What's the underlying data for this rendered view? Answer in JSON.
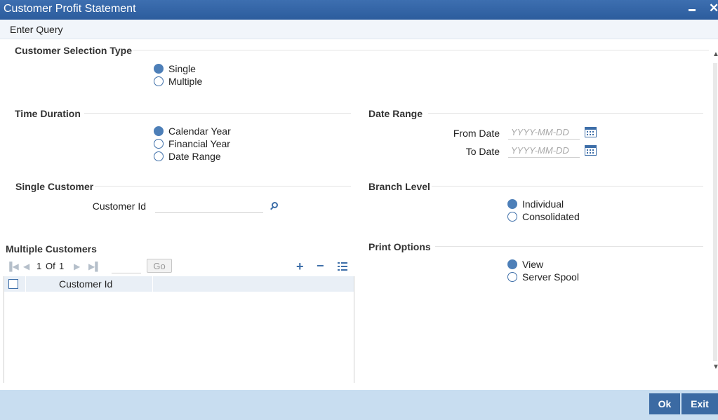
{
  "window": {
    "title": "Customer Profit Statement"
  },
  "menu": {
    "enter_query": "Enter Query"
  },
  "customer_selection": {
    "title": "Customer Selection Type",
    "options": [
      {
        "label": "Single",
        "selected": true
      },
      {
        "label": "Multiple",
        "selected": false
      }
    ]
  },
  "time_duration": {
    "title": "Time Duration",
    "options": [
      {
        "label": "Calendar Year",
        "selected": true
      },
      {
        "label": "Financial Year",
        "selected": false
      },
      {
        "label": "Date Range",
        "selected": false
      }
    ]
  },
  "date_range": {
    "title": "Date Range",
    "from_label": "From Date",
    "to_label": "To Date",
    "date_placeholder": "YYYY-MM-DD"
  },
  "single_customer": {
    "title": "Single Customer",
    "customer_id_label": "Customer Id",
    "customer_id_value": ""
  },
  "branch_level": {
    "title": "Branch Level",
    "options": [
      {
        "label": "Individual",
        "selected": true
      },
      {
        "label": "Consolidated",
        "selected": false
      }
    ]
  },
  "multiple_customers": {
    "title": "Multiple Customers",
    "pagination": {
      "current": "1",
      "of_label": "Of",
      "total": "1",
      "go_label": "Go"
    },
    "columns": [
      "Customer Id"
    ],
    "rows": []
  },
  "print_options": {
    "title": "Print Options",
    "options": [
      {
        "label": "View",
        "selected": true
      },
      {
        "label": "Server Spool",
        "selected": false
      }
    ]
  },
  "footer": {
    "ok_label": "Ok",
    "exit_label": "Exit"
  },
  "colors": {
    "title_bar": "#2f5f9f",
    "accent": "#3b6aa3",
    "footer_bg": "#c8ddf0"
  }
}
